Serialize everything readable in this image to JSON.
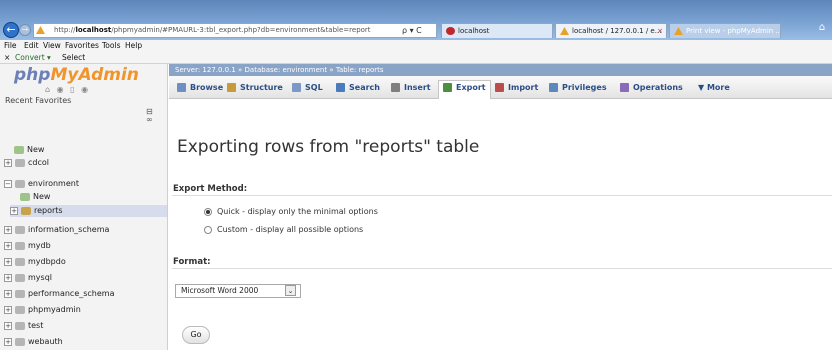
{
  "browser": {
    "address_prefix": "http://",
    "address_host": "localhost",
    "address_rest": "/phpmyadmin/#PMAURL-3:tbl_export.php?db=environment&table=report",
    "address_controls": "ρ ▾ C",
    "tabs": [
      {
        "label": "localhost",
        "close": ""
      },
      {
        "label": "localhost / 127.0.0.1 / e...",
        "close": "×"
      },
      {
        "label": "Print view - phpMyAdmin ...",
        "close": ""
      }
    ],
    "back_icon": "←",
    "forward_icon": "→",
    "home_icon": "⌂"
  },
  "menubar": [
    "File",
    "Edit",
    "View",
    "Favorites",
    "Tools",
    "Help"
  ],
  "cmdbar": {
    "close": "×",
    "convert": "Convert ▾",
    "select": "Select"
  },
  "sidebar": {
    "logo_php": "php",
    "logo_myadmin": "MyAdmin",
    "icons": "⌂ ◉ ▯ ◉",
    "recent": "Recent",
    "favorites": "Favorites",
    "collapse": "⊟ ∞",
    "tree": [
      {
        "label": "New",
        "type": "new",
        "expander": ""
      },
      {
        "label": "cdcol",
        "type": "db",
        "expander": "+"
      },
      {
        "label": "environment",
        "type": "db",
        "expander": "−"
      },
      {
        "label": "New",
        "type": "new",
        "expander": ""
      },
      {
        "label": "reports",
        "type": "table",
        "expander": "+"
      },
      {
        "label": "information_schema",
        "type": "db",
        "expander": "+"
      },
      {
        "label": "mydb",
        "type": "db",
        "expander": "+"
      },
      {
        "label": "mydbpdo",
        "type": "db",
        "expander": "+"
      },
      {
        "label": "mysql",
        "type": "db",
        "expander": "+"
      },
      {
        "label": "performance_schema",
        "type": "db",
        "expander": "+"
      },
      {
        "label": "phpmyadmin",
        "type": "db",
        "expander": "+"
      },
      {
        "label": "test",
        "type": "db",
        "expander": "+"
      },
      {
        "label": "webauth",
        "type": "db",
        "expander": "+"
      }
    ]
  },
  "breadcrumb": "Server: 127.0.0.1 » Database: environment » Table: reports",
  "tabs": [
    {
      "label": "Browse",
      "icon_color": "#6d8fc4"
    },
    {
      "label": "Structure",
      "icon_color": "#c79a3a"
    },
    {
      "label": "SQL",
      "icon_color": "#7b98c6"
    },
    {
      "label": "Search",
      "icon_color": "#4a7bbd"
    },
    {
      "label": "Insert",
      "icon_color": "#7f7f7f"
    },
    {
      "label": "Export",
      "icon_color": "#4c8f3f"
    },
    {
      "label": "Import",
      "icon_color": "#bb4d4d"
    },
    {
      "label": "Privileges",
      "icon_color": "#5d88bb"
    },
    {
      "label": "Operations",
      "icon_color": "#8a6bb5"
    },
    {
      "label": "▼ More",
      "icon_color": ""
    }
  ],
  "main": {
    "heading": "Exporting rows from \"reports\" table",
    "export_method_label": "Export Method:",
    "quick_option": "Quick - display only the minimal options",
    "custom_option": "Custom - display all possible options",
    "format_label": "Format:",
    "format_value": "Microsoft Word 2000",
    "format_arrow": "⌄",
    "go_label": "Go"
  }
}
